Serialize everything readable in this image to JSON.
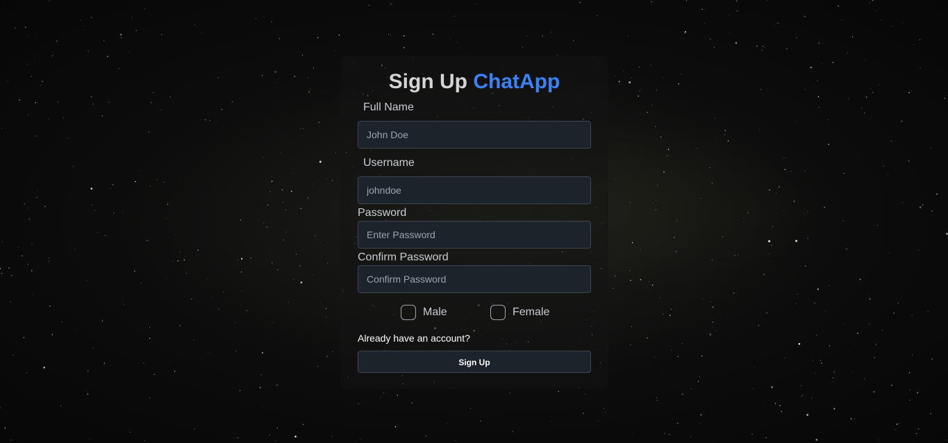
{
  "signup": {
    "title_prefix": "Sign Up",
    "title_brand": "ChatApp",
    "brand_color": "#3b82f6",
    "fields": {
      "full_name": {
        "label": "Full Name",
        "placeholder": "John Doe",
        "value": ""
      },
      "username": {
        "label": "Username",
        "placeholder": "johndoe",
        "value": ""
      },
      "password": {
        "label": "Password",
        "placeholder": "Enter Password",
        "value": ""
      },
      "confirm_password": {
        "label": "Confirm Password",
        "placeholder": "Confirm Password",
        "value": ""
      }
    },
    "gender": {
      "male_label": "Male",
      "female_label": "Female",
      "male_checked": false,
      "female_checked": false
    },
    "login_link": "Already have an account?",
    "submit_label": "Sign Up"
  }
}
